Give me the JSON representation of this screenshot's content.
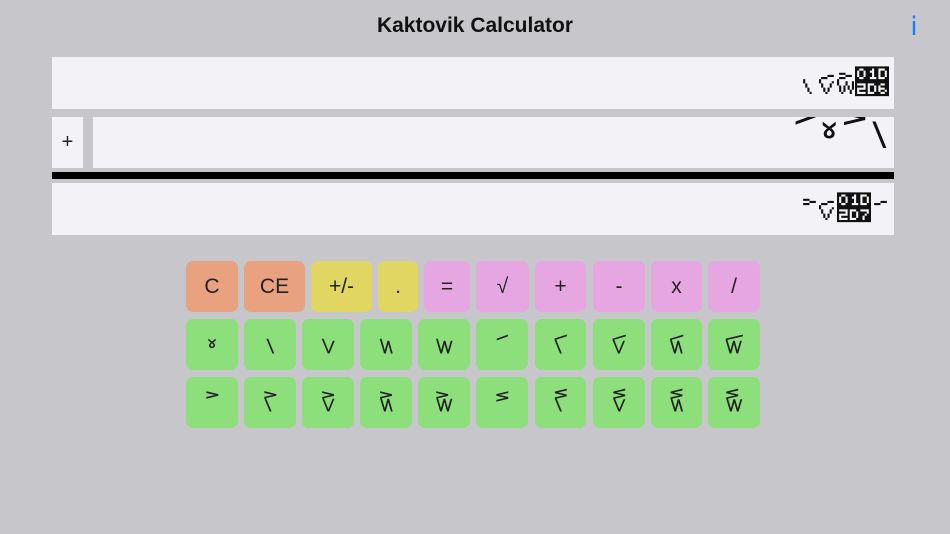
{
  "header": {
    "title": "Kaktovik Calculator",
    "info_label": "i"
  },
  "display": {
    "accumulator": "𝋁𝋇𝋎𝋖",
    "operator": "+",
    "operand": "𝋅𝋀𝋊𝋁",
    "result": "𝋊𝋇𝋗𝋅"
  },
  "keypad": {
    "function_keys": [
      "C",
      "CE",
      "+/-",
      ".",
      "=",
      "√",
      "+",
      "-",
      "x",
      "/"
    ],
    "digits_row1": [
      "𝋀",
      "𝋁",
      "𝋂",
      "𝋃",
      "𝋄",
      "𝋅",
      "𝋆",
      "𝋇",
      "𝋈",
      "𝋉"
    ],
    "digits_row2": [
      "𝋊",
      "𝋋",
      "𝋌",
      "𝋍",
      "𝋎",
      "𝋏",
      "𝋐",
      "𝋑",
      "𝋒",
      "𝋓"
    ]
  },
  "colors": {
    "background": "#c7c6cb",
    "panel": "#f3f3f7",
    "clear_keys": "#e9a280",
    "edit_keys": "#e1d661",
    "operator_keys": "#e5a6e2",
    "digit_keys": "#8ddf7c",
    "accent": "#1c7cf5"
  }
}
